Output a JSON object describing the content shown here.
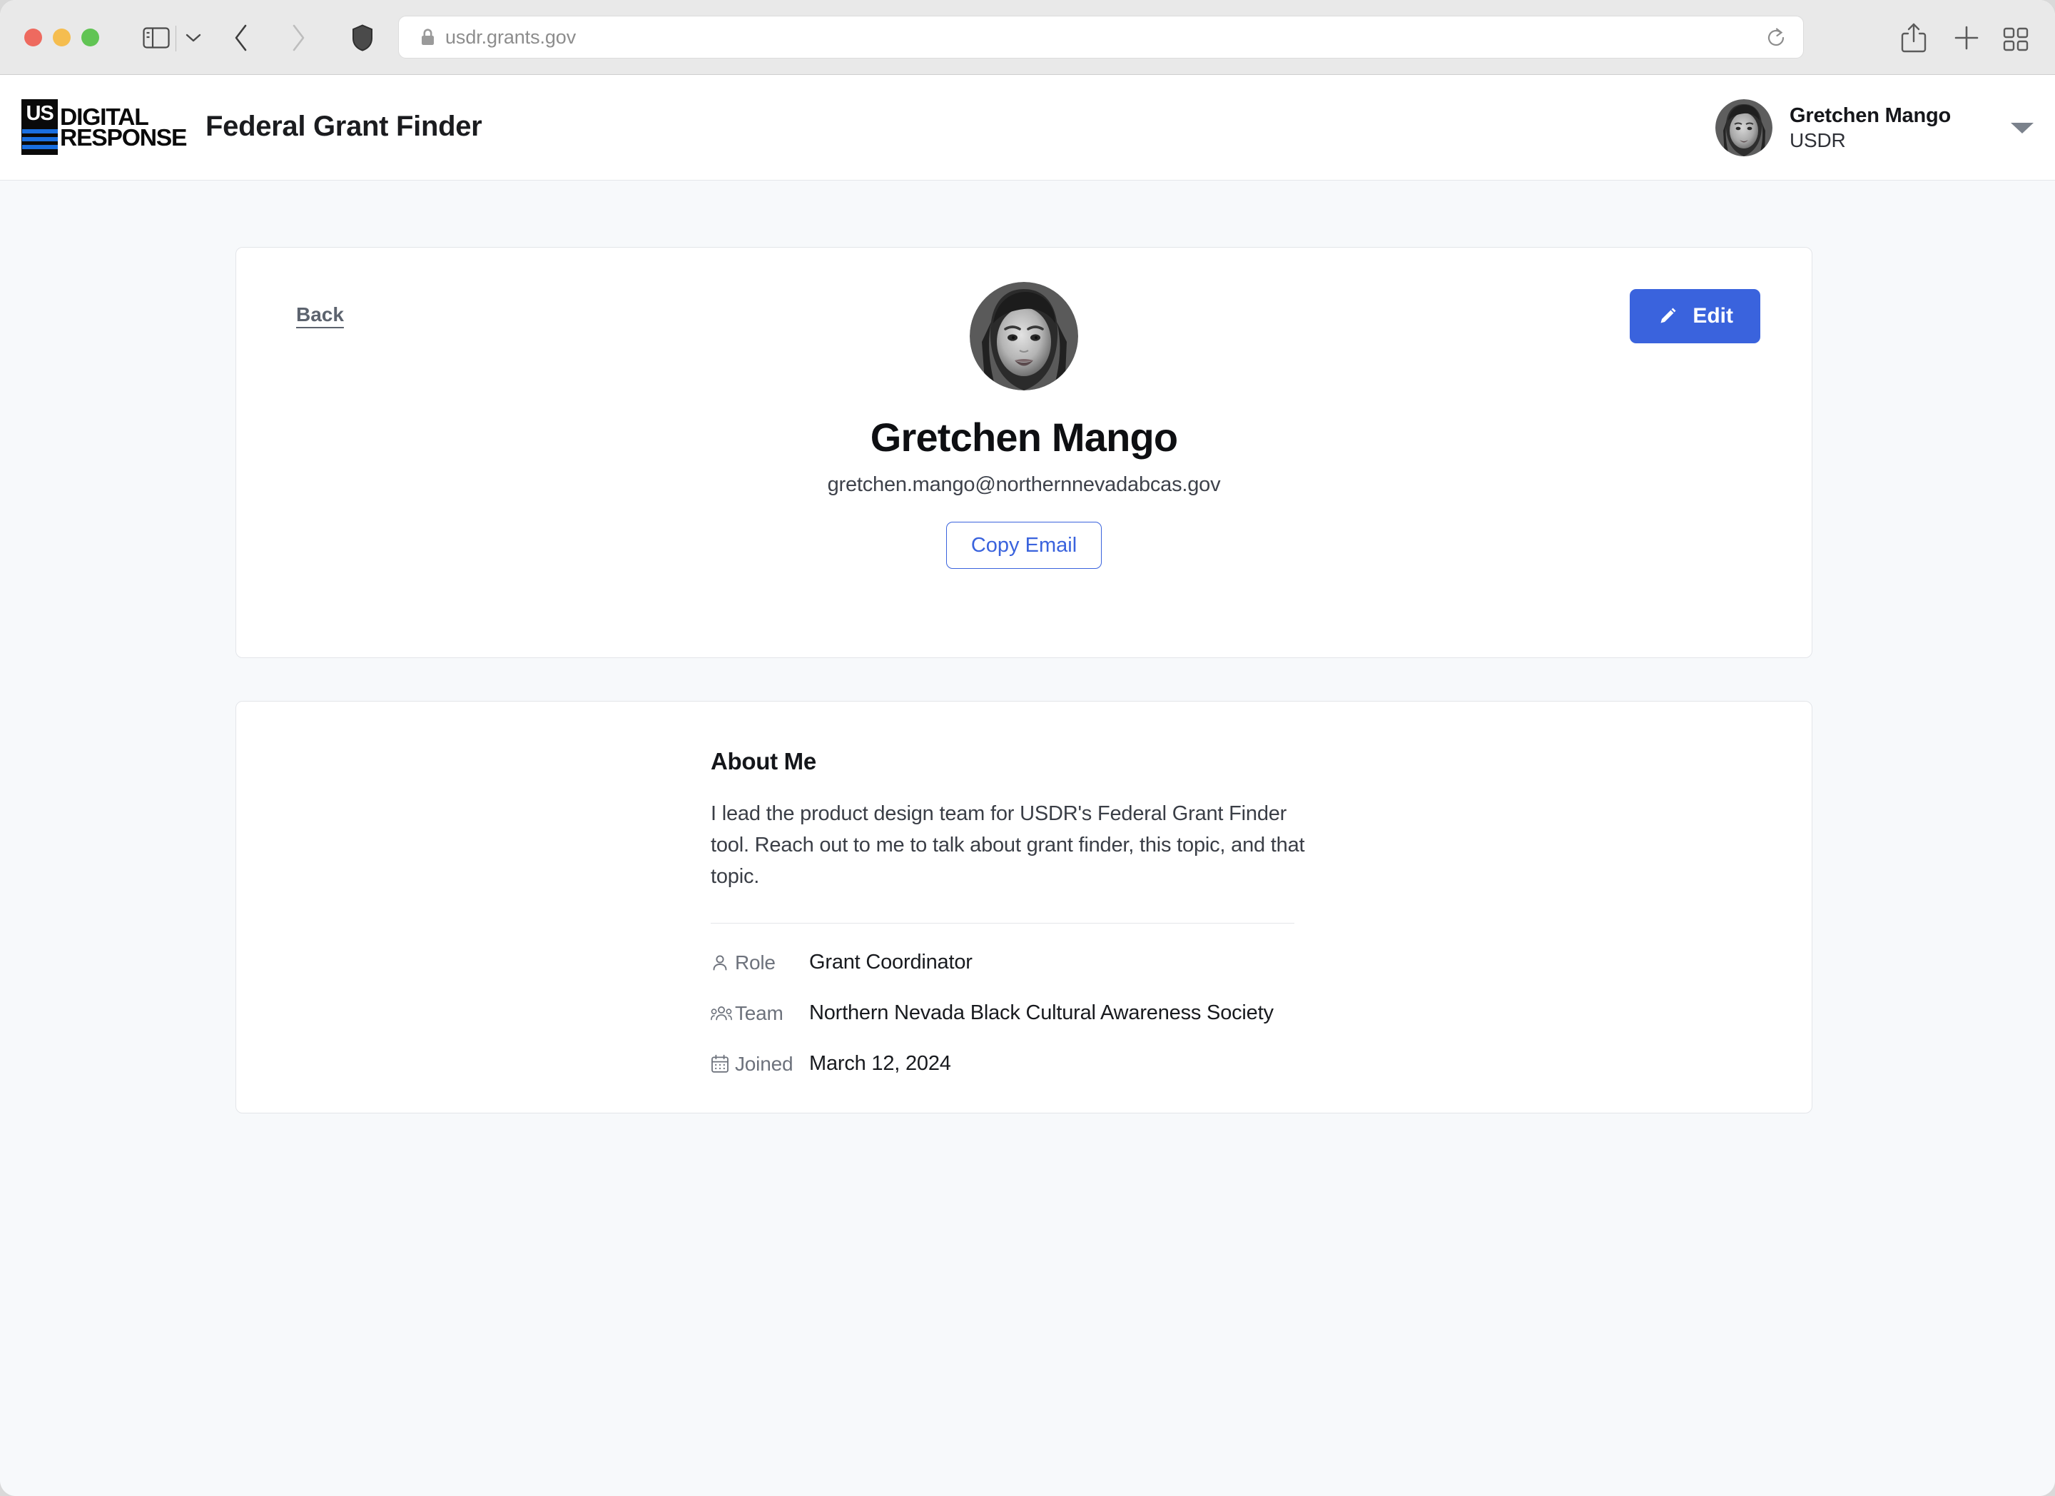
{
  "browser": {
    "url": "usdr.grants.gov",
    "icons": {
      "sidebar": "sidebar-icon",
      "sidebar_chevron": "chevron-down-icon",
      "back": "back-arrow-icon",
      "forward": "forward-arrow-icon",
      "shield": "shield-icon",
      "lock": "lock-icon",
      "reload": "reload-icon",
      "share": "share-icon",
      "new_tab": "plus-icon",
      "tab_overview": "tab-overview-icon"
    }
  },
  "header": {
    "logo": {
      "mark_text": "US",
      "word_1": "DIGITAL",
      "word_2": "RESPONSE"
    },
    "app_title": "Federal Grant Finder",
    "user": {
      "name": "Gretchen Mango",
      "org": "USDR"
    }
  },
  "profile_card": {
    "back_label": "Back",
    "edit_label": "Edit",
    "edit_icon": "pencil-icon",
    "name": "Gretchen Mango",
    "email": "gretchen.mango@northernnevadabcas.gov",
    "copy_email_label": "Copy Email"
  },
  "about_card": {
    "heading": "About Me",
    "bio": "I lead the product design team for USDR's Federal Grant Finder tool. Reach out to me to talk about grant finder, this topic, and that topic.",
    "meta": [
      {
        "icon": "person-icon",
        "label": "Role",
        "value": "Grant Coordinator"
      },
      {
        "icon": "people-icon",
        "label": "Team",
        "value": "Northern Nevada Black Cultural Awareness Society"
      },
      {
        "icon": "calendar-icon",
        "label": "Joined",
        "value": "March 12, 2024"
      }
    ]
  },
  "colors": {
    "accent_blue": "#3a63dd",
    "logo_blue": "#1a6fe0",
    "page_background": "#f7f9fb",
    "card_border": "#e3e5e9"
  }
}
